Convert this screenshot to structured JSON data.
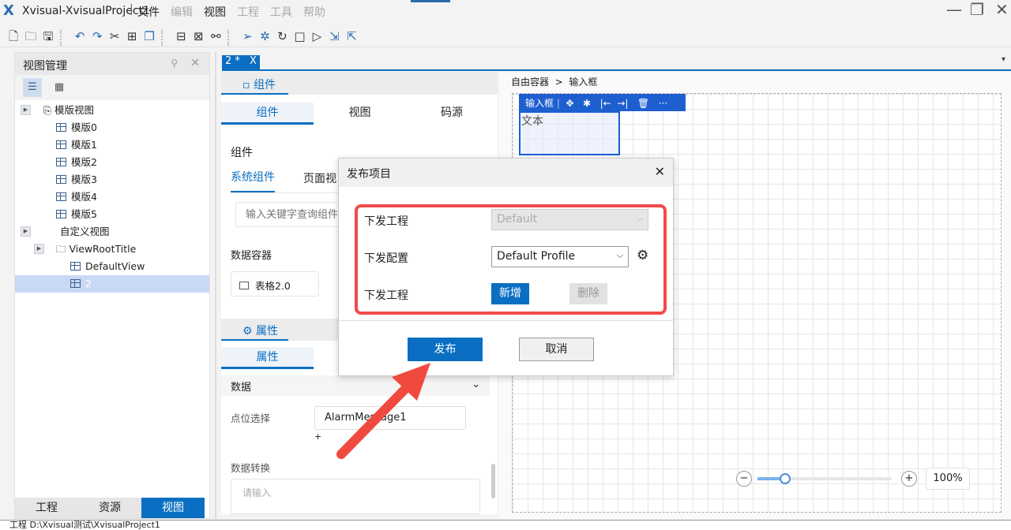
{
  "app": {
    "title": "Xvisual-XvisualProject1",
    "menu": [
      "文件",
      "编辑",
      "视图",
      "工程",
      "工具",
      "帮助"
    ]
  },
  "window_controls": {
    "minimize": "—",
    "maximize": "❐",
    "close": "✕"
  },
  "left_panel": {
    "title": "视图管理",
    "tree": [
      {
        "label": "模版视图"
      },
      {
        "label": "模版0"
      },
      {
        "label": "模版1"
      },
      {
        "label": "模版2"
      },
      {
        "label": "模版3"
      },
      {
        "label": "模版4"
      },
      {
        "label": "模版5"
      },
      {
        "label": "自定义视图"
      },
      {
        "label": "ViewRootTitle"
      },
      {
        "label": "DefaultView"
      },
      {
        "label": "2"
      }
    ],
    "bottom_tabs": [
      "工程",
      "资源",
      "视图"
    ]
  },
  "editor_tab": {
    "label": "2 *",
    "close": "X"
  },
  "component_panel": {
    "header": "组件",
    "subtabs": [
      "组件",
      "视图",
      "码源"
    ],
    "section_title": "组件",
    "category_tabs": [
      "系统组件",
      "页面视"
    ],
    "search_placeholder": "输入关键字查询组件",
    "group": "数据容器",
    "item": "表格2.0"
  },
  "property_panel": {
    "header": "属性",
    "subtab": "属性",
    "section": "数据",
    "point_label": "点位选择",
    "point_value": "AlarmMessage1",
    "add": "+",
    "convert_label": "数据转换",
    "convert_placeholder": "请输入"
  },
  "canvas": {
    "breadcrumb": [
      "自由容器",
      ">",
      "输入框"
    ],
    "widget_toolbar_label": "输入框",
    "widget_text": "文本",
    "zoom": "100%",
    "zoom_fraction": 0.2
  },
  "dialog": {
    "title": "发布项目",
    "rows": [
      {
        "label": "下发工程",
        "value": "Default"
      },
      {
        "label": "下发配置",
        "value": "Default Profile"
      },
      {
        "label": "下发工程",
        "add": "新增",
        "delete": "删除"
      }
    ],
    "publish": "发布",
    "cancel": "取消"
  },
  "status": "工程 D:\\Xvisual测试\\XvisualProject1"
}
